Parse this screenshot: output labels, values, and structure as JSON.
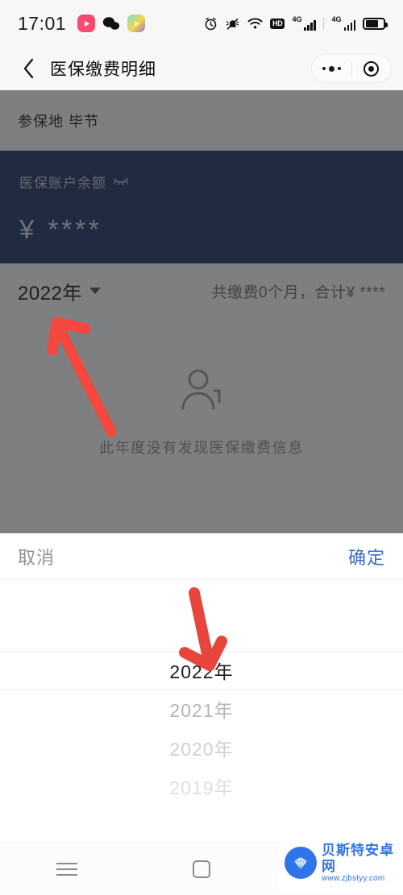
{
  "status_bar": {
    "time": "17:01",
    "app_icons": [
      "kuaishou-icon",
      "wechat-icon",
      "media-app-icon"
    ],
    "right_icons": [
      "alarm-icon",
      "mute-bell-icon",
      "wifi-icon",
      "hd-badge",
      "signal-4g-1",
      "signal-4g-2",
      "battery-icon"
    ],
    "hd_label": "HD",
    "network_label_1": "4G",
    "network_label_2": "4G"
  },
  "navbar": {
    "back_icon": "back-chevron-icon",
    "title": "医保缴费明细",
    "capsule": {
      "menu_icon": "more-dots-icon",
      "close_icon": "target-circle-icon"
    }
  },
  "page": {
    "region": {
      "label": "参保地",
      "value": "毕节",
      "full": "参保地 毕节"
    },
    "balance_card": {
      "label": "医保账户余额",
      "eye_icon": "eye-closed-icon",
      "currency": "¥",
      "amount": "****",
      "display": "¥ ****",
      "bg_color": "#152c5f"
    },
    "summary": {
      "year": "2022年",
      "caret_icon": "chevron-down-icon",
      "text": "共缴费0个月，合计¥ ****"
    },
    "empty_state": {
      "icon": "person-empty-icon",
      "text": "此年度没有发现医保缴费信息"
    }
  },
  "picker_sheet": {
    "cancel_label": "取消",
    "confirm_label": "确定",
    "confirm_color": "#3d6cc0",
    "options": [
      "2022年",
      "2021年",
      "2020年",
      "2019年"
    ],
    "selected": "2022年"
  },
  "annotations": {
    "arrow_up": {
      "color": "#f4483f",
      "points_to": "2022年"
    },
    "arrow_down": {
      "color": "#e8453c",
      "points_to": "2022年"
    }
  },
  "system_nav": {
    "menu_icon": "hamburger-icon",
    "home_icon": "home-square-icon",
    "back_icon": "back-arrow-icon"
  },
  "watermark": {
    "name": "贝斯特安卓网",
    "url": "www.zjbstyy.com",
    "color": "#2f74e8"
  }
}
